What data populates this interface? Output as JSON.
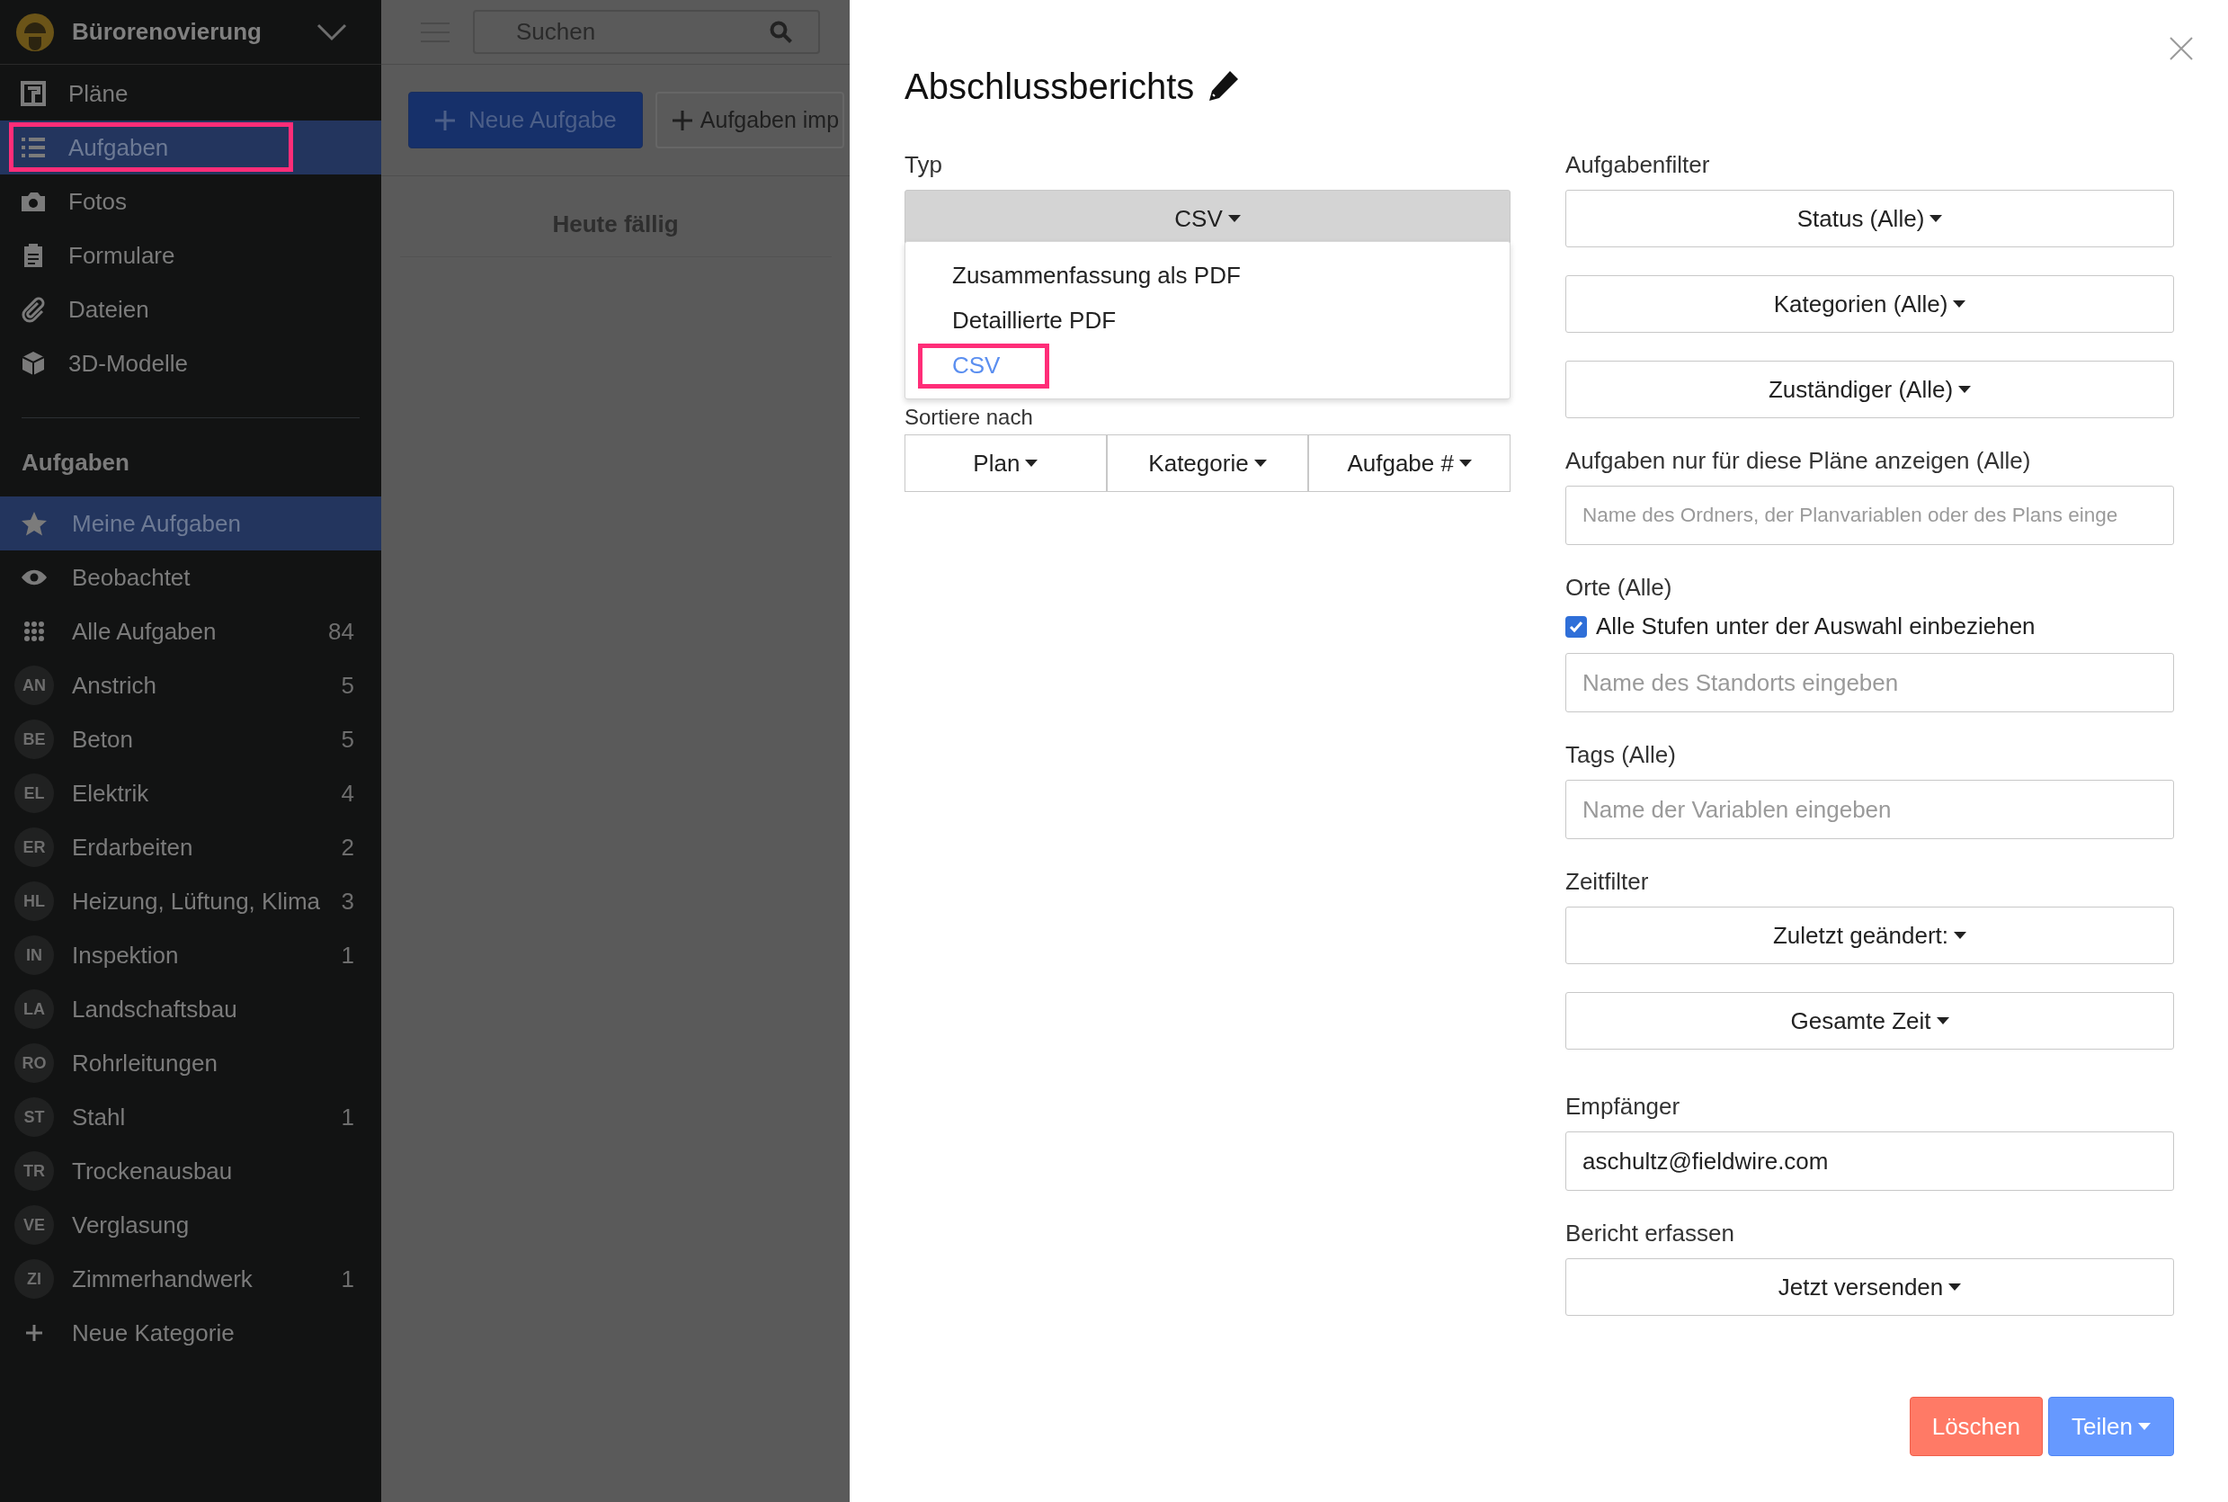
{
  "sidebar": {
    "project": "Bürorenovierung",
    "nav": [
      {
        "kind": "plan",
        "label": "Pläne",
        "selected": false,
        "highlighted": false
      },
      {
        "kind": "list",
        "label": "Aufgaben",
        "selected": true,
        "highlighted": true
      },
      {
        "kind": "camera",
        "label": "Fotos",
        "selected": false,
        "highlighted": false
      },
      {
        "kind": "clipboard",
        "label": "Formulare",
        "selected": false,
        "highlighted": false
      },
      {
        "kind": "clip",
        "label": "Dateien",
        "selected": false,
        "highlighted": false
      },
      {
        "kind": "cube",
        "label": "3D-Modelle",
        "selected": false,
        "highlighted": false
      }
    ],
    "section_title": "Aufgaben",
    "items": [
      {
        "kind": "star",
        "label": "Meine Aufgaben",
        "selected": true
      },
      {
        "kind": "eye",
        "label": "Beobachtet",
        "selected": false
      },
      {
        "kind": "grid",
        "label": "Alle Aufgaben",
        "count": "84",
        "selected": false
      },
      {
        "kind": "category",
        "badge": "AN",
        "label": "Anstrich",
        "count": "5",
        "selected": false
      },
      {
        "kind": "category",
        "badge": "BE",
        "label": "Beton",
        "count": "5",
        "selected": false
      },
      {
        "kind": "category",
        "badge": "EL",
        "label": "Elektrik",
        "count": "4",
        "selected": false
      },
      {
        "kind": "category",
        "badge": "ER",
        "label": "Erdarbeiten",
        "count": "2",
        "selected": false
      },
      {
        "kind": "category",
        "badge": "HL",
        "label": "Heizung, Lüftung, Klima",
        "count": "3",
        "selected": false
      },
      {
        "kind": "category",
        "badge": "IN",
        "label": "Inspektion",
        "count": "1",
        "selected": false
      },
      {
        "kind": "category",
        "badge": "LA",
        "label": "Landschaftsbau",
        "selected": false
      },
      {
        "kind": "category",
        "badge": "RO",
        "label": "Rohrleitungen",
        "selected": false
      },
      {
        "kind": "category",
        "badge": "ST",
        "label": "Stahl",
        "count": "1",
        "selected": false
      },
      {
        "kind": "category",
        "badge": "TR",
        "label": "Trockenausbau",
        "selected": false
      },
      {
        "kind": "category",
        "badge": "VE",
        "label": "Verglasung",
        "selected": false
      },
      {
        "kind": "category",
        "badge": "ZI",
        "label": "Zimmerhandwerk",
        "count": "1",
        "selected": false
      },
      {
        "kind": "add",
        "label": "Neue Kategorie",
        "selected": false
      }
    ]
  },
  "main": {
    "search": {
      "placeholder": "Suchen"
    },
    "buttons": [
      "Neue Aufgabe",
      "Aufgaben imp"
    ],
    "section": "Heute fällig"
  },
  "modal": {
    "title": "Abschlussberichts",
    "type": {
      "label": "Typ",
      "value": "CSV",
      "options": [
        {
          "label": "Zusammenfassung als PDF",
          "selected": false,
          "highlighted": false
        },
        {
          "label": "Detaillierte PDF",
          "selected": false,
          "highlighted": false
        },
        {
          "label": "CSV",
          "selected": true,
          "highlighted": true
        }
      ]
    },
    "sort": {
      "label": "Sortiere nach",
      "buttons": [
        "Plan",
        "Kategorie",
        "Aufgabe #"
      ]
    },
    "right": [
      {
        "label": "Aufgabenfilter",
        "controls": [
          {
            "kind": "dropdown",
            "text": "Status (Alle)"
          },
          {
            "kind": "dropdown",
            "text": "Kategorien (Alle)"
          },
          {
            "kind": "dropdown",
            "text": "Zuständiger (Alle)"
          }
        ]
      },
      {
        "label": "Aufgaben nur für diese Pläne anzeigen (Alle)",
        "controls": [
          {
            "kind": "input",
            "placeholder": "Name des Ordners, der Planvariablen oder des Plans einge"
          }
        ]
      },
      {
        "label": "Orte (Alle)",
        "controls": [
          {
            "kind": "checkbox",
            "text": "Alle Stufen unter der Auswahl einbeziehen",
            "checked": true
          },
          {
            "kind": "input",
            "placeholder": "Name des Standorts eingeben"
          }
        ]
      },
      {
        "label": "Tags (Alle)",
        "controls": [
          {
            "kind": "input",
            "placeholder": "Name der Variablen eingeben"
          }
        ]
      },
      {
        "label": "Zeitfilter",
        "controls": [
          {
            "kind": "dropdown",
            "text": "Zuletzt geändert:"
          },
          {
            "kind": "dropdown",
            "text": "Gesamte Zeit"
          }
        ]
      },
      {
        "label": "Empfänger",
        "controls": [
          {
            "kind": "input",
            "value": "aschultz@fieldwire.com"
          }
        ]
      },
      {
        "label": "Bericht erfassen",
        "controls": [
          {
            "kind": "dropdown",
            "text": "Jetzt versenden"
          }
        ]
      }
    ],
    "delete": "Löschen",
    "share": "Teilen"
  }
}
